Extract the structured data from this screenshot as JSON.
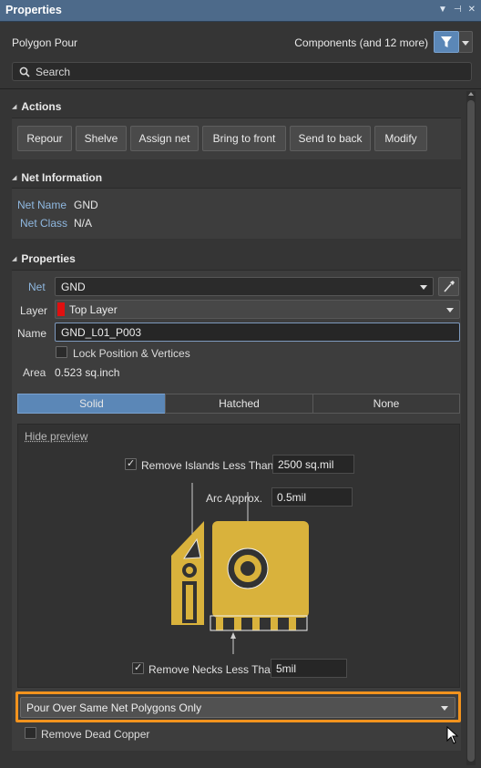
{
  "window": {
    "title": "Properties"
  },
  "header": {
    "object_type": "Polygon Pour",
    "filter_text": "Components (and 12 more)"
  },
  "search": {
    "placeholder": "Search"
  },
  "actions": {
    "title": "Actions",
    "buttons": [
      "Repour",
      "Shelve",
      "Assign net",
      "Bring to front",
      "Send to back",
      "Modify"
    ]
  },
  "net_info": {
    "title": "Net Information",
    "net_name_label": "Net Name",
    "net_name_value": "GND",
    "net_class_label": "Net Class",
    "net_class_value": "N/A"
  },
  "properties": {
    "title": "Properties",
    "net_label": "Net",
    "net_value": "GND",
    "layer_label": "Layer",
    "layer_value": "Top Layer",
    "layer_color": "#e01010",
    "name_label": "Name",
    "name_value": "GND_L01_P003",
    "lock_label": "Lock Position & Vertices",
    "area_label": "Area",
    "area_value": "0.523 sq.inch"
  },
  "fill_modes": {
    "options": [
      "Solid",
      "Hatched",
      "None"
    ],
    "selected": "Solid"
  },
  "preview": {
    "hide_label": "Hide preview",
    "remove_islands_label": "Remove Islands Less Than",
    "remove_islands_value": "2500 sq.mil",
    "arc_label": "Arc Approx.",
    "arc_value": "0.5mil",
    "remove_necks_label": "Remove Necks Less Than",
    "remove_necks_value": "5mil"
  },
  "pour_over": {
    "value": "Pour Over Same Net Polygons Only"
  },
  "dead_copper": {
    "label": "Remove Dead Copper"
  },
  "colors": {
    "accent": "#5b87b7",
    "copper": "#d9b23c",
    "highlight": "#f2931e",
    "title_bar": "#4d6a8a"
  }
}
